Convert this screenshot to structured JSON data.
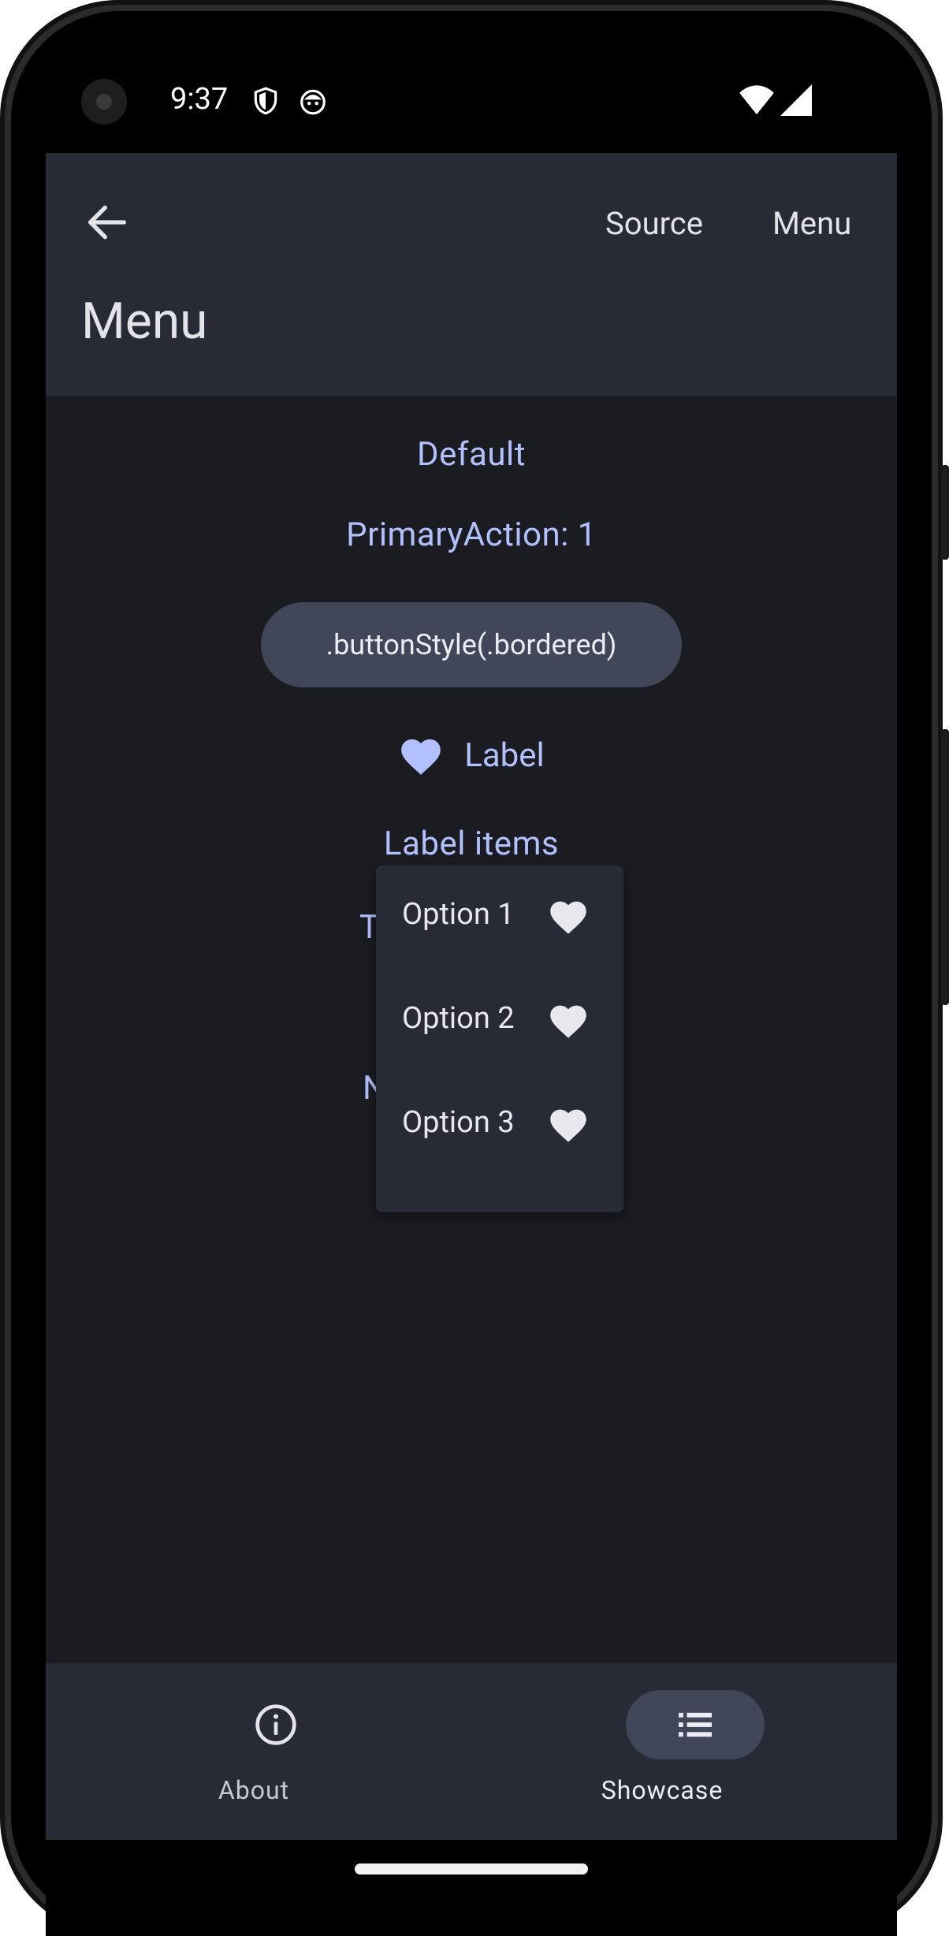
{
  "status_bar": {
    "time": "9:37",
    "left_icons": [
      "shield-icon",
      "android-face-icon"
    ],
    "right_icons": [
      "wifi-icon",
      "signal-icon"
    ]
  },
  "app_bar": {
    "back_icon": "arrow-back-icon",
    "actions": [
      "Source",
      "Menu"
    ],
    "title": "Menu"
  },
  "content": {
    "items": [
      "Default",
      "PrimaryAction: 1"
    ],
    "bordered_button": ".buttonStyle(.bordered)",
    "label_button": {
      "icon": "heart-icon",
      "label": "Label"
    },
    "label_items": "Label items",
    "obscured_items": [
      "T",
      "N"
    ]
  },
  "popup_menu": {
    "options": [
      {
        "label": "Option 1",
        "icon": "heart-icon"
      },
      {
        "label": "Option 2",
        "icon": "heart-icon"
      },
      {
        "label": "Option 3",
        "icon": "heart-icon"
      }
    ]
  },
  "bottom_nav": {
    "items": [
      {
        "label": "About",
        "icon": "info-icon",
        "selected": false
      },
      {
        "label": "Showcase",
        "icon": "list-icon",
        "selected": true
      }
    ]
  },
  "colors": {
    "app_bar": "#282a35",
    "content_bg": "#1b1c21",
    "link": "#b3c0ff",
    "pill": "#424659",
    "text": "#e3e3ea"
  }
}
